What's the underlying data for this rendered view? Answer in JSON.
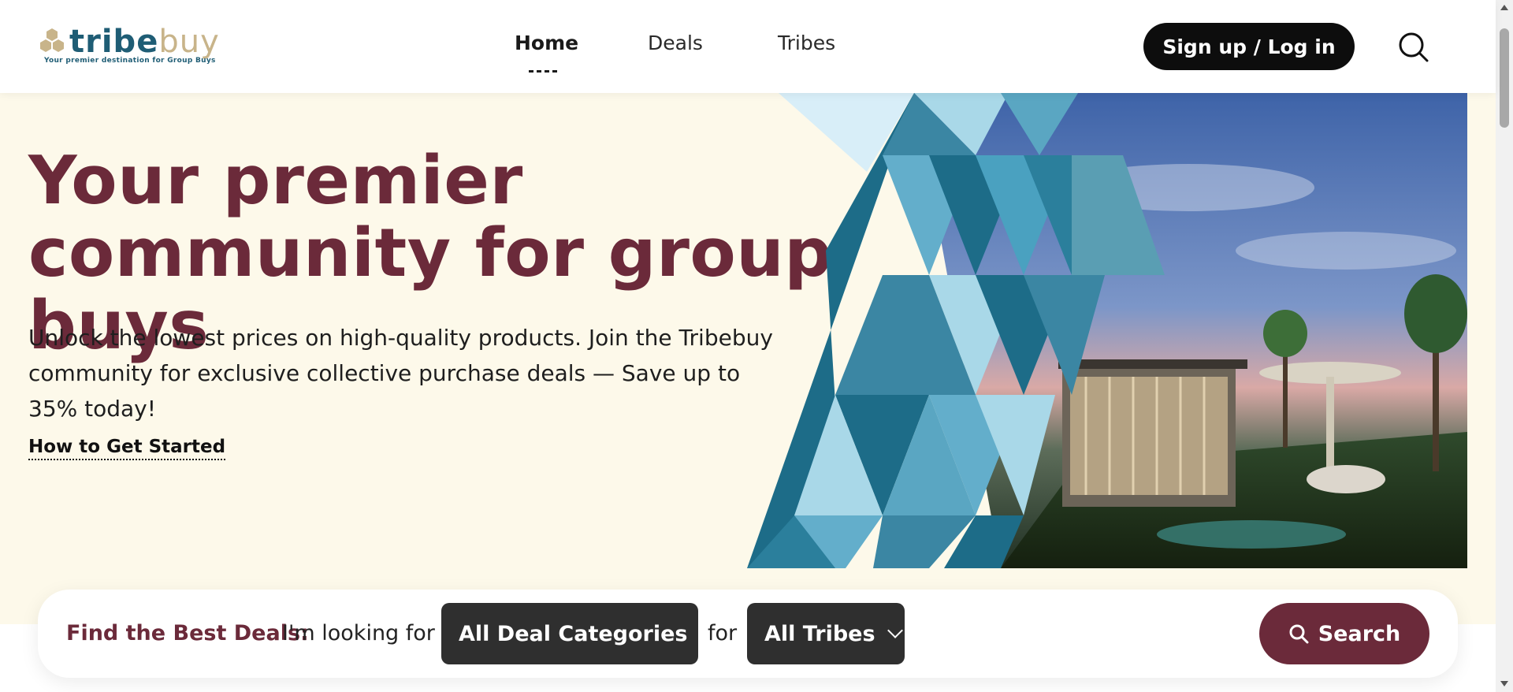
{
  "header": {
    "logo": {
      "word_part1": "tribe",
      "word_part2": "buy",
      "tagline": "Your premier destination for Group Buys"
    },
    "nav": [
      {
        "label": "Home",
        "active": true
      },
      {
        "label": "Deals",
        "active": false
      },
      {
        "label": "Tribes",
        "active": false
      }
    ],
    "signup_label": "Sign up / Log in",
    "search_icon": "search-icon"
  },
  "hero": {
    "title": "Your premier community for group buys",
    "subtitle": "Unlock the lowest prices on high-quality products. Join the Tribebuy community for exclusive collective purchase deals — Save up to 35% today!",
    "link_label": "How to Get Started"
  },
  "search_bar": {
    "label": "Find the Best Deals:",
    "text_looking": "I'm looking for",
    "category_select": "All Deal Categories",
    "text_for": "for",
    "tribe_select": "All Tribes",
    "search_label": "Search"
  },
  "colors": {
    "brand_maroon": "#6b2a3a",
    "brand_teal": "#1f5d75",
    "logo_gold": "#c8b48a",
    "hero_bg": "#fdf9ea",
    "dark_button": "#0d0d0d"
  }
}
